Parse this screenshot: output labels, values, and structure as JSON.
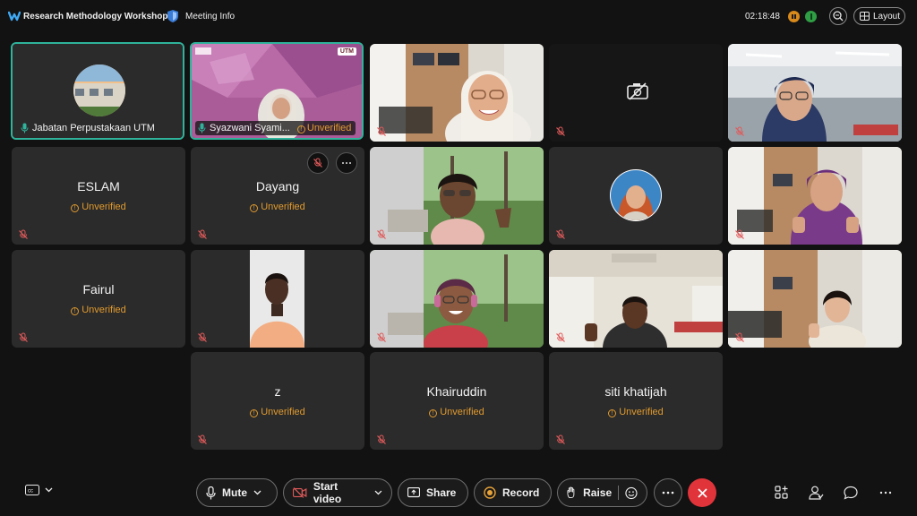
{
  "header": {
    "meeting_title": "Research Methodology Workshop",
    "meeting_info": "Meeting Info",
    "timer": "02:18:48",
    "layout_label": "Layout"
  },
  "participants": [
    {
      "name": "Jabatan Perpustakaan UTM",
      "video": true,
      "active_speaker": true,
      "unverified": false
    },
    {
      "name": "Syazwani Syami...",
      "video": true,
      "active_speaker": true,
      "unverified": true,
      "badge": "UTM"
    },
    {
      "name": "",
      "video": true
    },
    {
      "name": "",
      "video": false,
      "camera_off_icon": true
    },
    {
      "name": "",
      "video": true
    },
    {
      "name": "ESLAM",
      "video": false,
      "unverified": true
    },
    {
      "name": "Dayang",
      "video": false,
      "unverified": true
    },
    {
      "name": "",
      "video": true
    },
    {
      "name": "",
      "video": false,
      "avatar": true
    },
    {
      "name": "",
      "video": true
    },
    {
      "name": "Fairul",
      "video": false,
      "unverified": true
    },
    {
      "name": "",
      "video": true
    },
    {
      "name": "",
      "video": true
    },
    {
      "name": "",
      "video": true
    },
    {
      "name": "",
      "video": true
    },
    {
      "name": "z",
      "video": false,
      "unverified": true
    },
    {
      "name": "Khairuddin",
      "video": false,
      "unverified": true
    },
    {
      "name": "siti khatijah",
      "video": false,
      "unverified": true
    }
  ],
  "unverified_label": "Unverified",
  "controls": {
    "mute": "Mute",
    "start_video": "Start video",
    "share": "Share",
    "record": "Record",
    "raise": "Raise"
  },
  "colors": {
    "accent": "#2fb39b",
    "warning": "#e09a2e",
    "end_call": "#e0343a",
    "tile_bg": "#2b2b2b",
    "app_bg": "#121212"
  }
}
